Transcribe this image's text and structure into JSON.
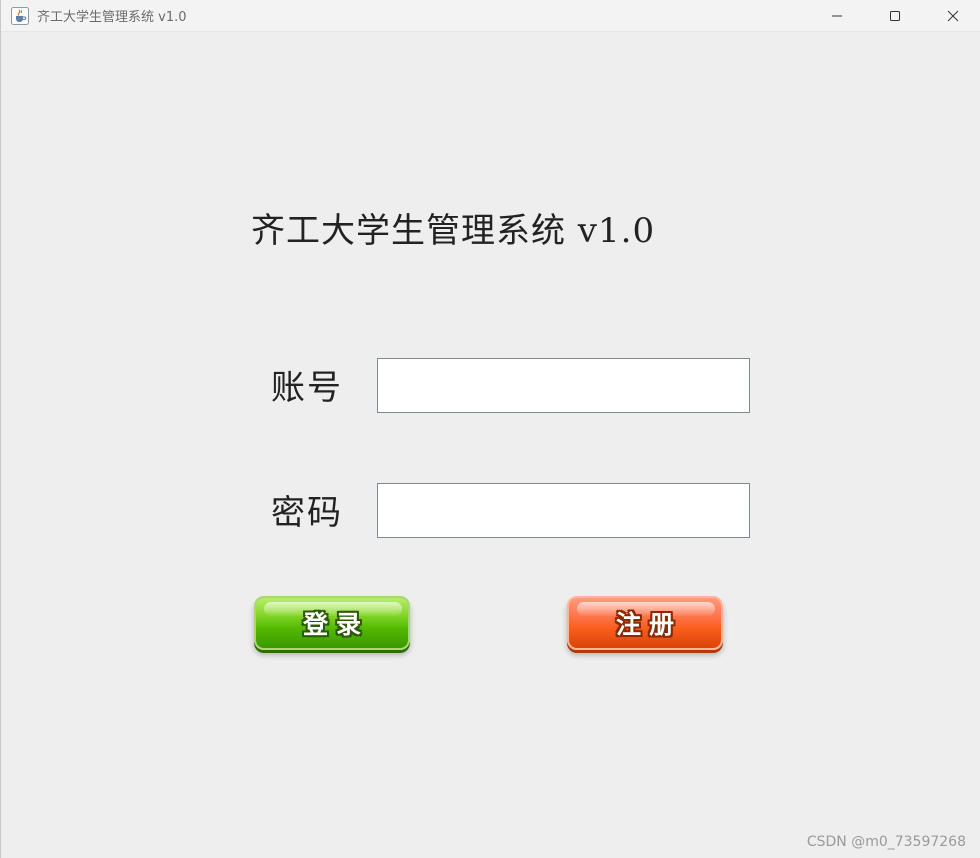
{
  "window": {
    "title": "齐工大学生管理系统 v1.0",
    "icon": "java-cup-icon"
  },
  "controls": {
    "minimize_icon": "minimize-icon",
    "maximize_icon": "maximize-icon",
    "close_icon": "close-icon"
  },
  "main": {
    "heading": "齐工大学生管理系统 v1.0",
    "account_label": "账号",
    "account_value": "",
    "password_label": "密码",
    "password_value": "",
    "login_label": "登录",
    "register_label": "注册"
  },
  "watermark": "CSDN @m0_73597268",
  "colors": {
    "login_button": "#52b800",
    "register_button": "#f95d1c",
    "background": "#eeeeee"
  }
}
